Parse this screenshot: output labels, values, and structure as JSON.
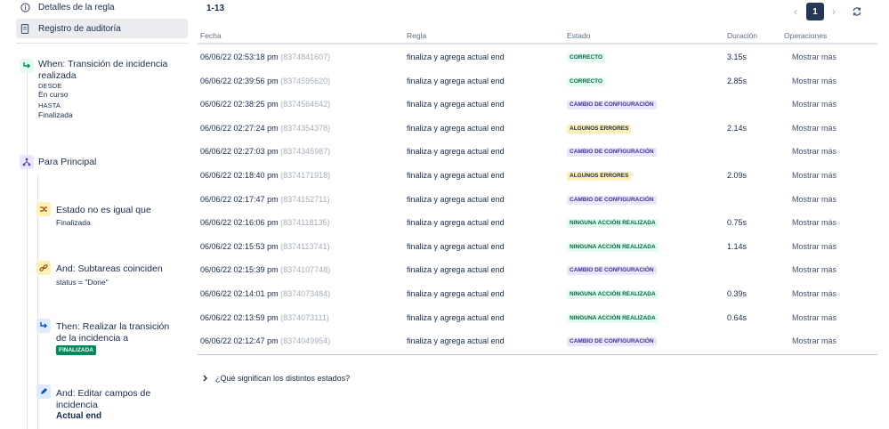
{
  "sidebar": {
    "nav": [
      {
        "label": "Detalles de la regla",
        "icon": "info-icon"
      },
      {
        "label": "Registro de auditoría",
        "icon": "document-icon"
      }
    ],
    "components": {
      "trigger": {
        "title_line1": "When: Transición de incidencia",
        "title_line2": "realizada",
        "from_label": "DESDE",
        "from_value": "En curso",
        "to_label": "HASTA",
        "to_value": "Finalizada"
      },
      "branch": {
        "title": "Para Principal"
      },
      "condition1": {
        "title": "Estado no es igual que",
        "detail": "Finalizada"
      },
      "condition2": {
        "title": "And: Subtareas coinciden",
        "detail": "status = \"Done\""
      },
      "action1": {
        "title_line1": "Then: Realizar la transición",
        "title_line2": "de la incidencia a",
        "lozenge": "FINALIZADA"
      },
      "action2": {
        "title_line1": "And: Editar campos de",
        "title_line2": "incidencia",
        "detail": "Actual end"
      }
    }
  },
  "main": {
    "count": "1-13",
    "pager": {
      "prev": "‹",
      "current": "1",
      "next": "›"
    },
    "columns": [
      "Fecha",
      "Regla",
      "Estado",
      "Duración",
      "Operaciones"
    ],
    "rows": [
      {
        "date": "06/06/22 02:53:18 pm",
        "id": "(8374841607)",
        "rule": "finaliza y agrega actual end",
        "status": "CORRECTO",
        "kind": "green",
        "duration": "3.15s",
        "op": "Mostrar más"
      },
      {
        "date": "06/06/22 02:39:56 pm",
        "id": "(8374595620)",
        "rule": "finaliza y agrega actual end",
        "status": "CORRECTO",
        "kind": "green",
        "duration": "2.85s",
        "op": "Mostrar más"
      },
      {
        "date": "06/06/22 02:38:25 pm",
        "id": "(8374564642)",
        "rule": "finaliza y agrega actual end",
        "status": "CAMBIO DE CONFIGURACIÓN",
        "kind": "purple",
        "duration": "",
        "op": "Mostrar más"
      },
      {
        "date": "06/06/22 02:27:24 pm",
        "id": "(8374354378)",
        "rule": "finaliza y agrega actual end",
        "status": "ALGUNOS ERRORES",
        "kind": "yellow",
        "duration": "2.14s",
        "op": "Mostrar más"
      },
      {
        "date": "06/06/22 02:27:03 pm",
        "id": "(8374345987)",
        "rule": "finaliza y agrega actual end",
        "status": "CAMBIO DE CONFIGURACIÓN",
        "kind": "purple",
        "duration": "",
        "op": "Mostrar más"
      },
      {
        "date": "06/06/22 02:18:40 pm",
        "id": "(8374171918)",
        "rule": "finaliza y agrega actual end",
        "status": "ALGUNOS ERRORES",
        "kind": "yellow",
        "duration": "2.09s",
        "op": "Mostrar más"
      },
      {
        "date": "06/06/22 02:17:47 pm",
        "id": "(8374152711)",
        "rule": "finaliza y agrega actual end",
        "status": "CAMBIO DE CONFIGURACIÓN",
        "kind": "purple",
        "duration": "",
        "op": "Mostrar más"
      },
      {
        "date": "06/06/22 02:16:06 pm",
        "id": "(8374118135)",
        "rule": "finaliza y agrega actual end",
        "status": "NINGUNA ACCIÓN REALIZADA",
        "kind": "green",
        "duration": "0.75s",
        "op": "Mostrar más"
      },
      {
        "date": "06/06/22 02:15:53 pm",
        "id": "(8374113741)",
        "rule": "finaliza y agrega actual end",
        "status": "NINGUNA ACCIÓN REALIZADA",
        "kind": "green",
        "duration": "1.14s",
        "op": "Mostrar más"
      },
      {
        "date": "06/06/22 02:15:39 pm",
        "id": "(8374107748)",
        "rule": "finaliza y agrega actual end",
        "status": "CAMBIO DE CONFIGURACIÓN",
        "kind": "purple",
        "duration": "",
        "op": "Mostrar más"
      },
      {
        "date": "06/06/22 02:14:01 pm",
        "id": "(8374073484)",
        "rule": "finaliza y agrega actual end",
        "status": "NINGUNA ACCIÓN REALIZADA",
        "kind": "green",
        "duration": "0.39s",
        "op": "Mostrar más"
      },
      {
        "date": "06/06/22 02:13:59 pm",
        "id": "(8374073111)",
        "rule": "finaliza y agrega actual end",
        "status": "NINGUNA ACCIÓN REALIZADA",
        "kind": "green",
        "duration": "0.64s",
        "op": "Mostrar más"
      },
      {
        "date": "06/06/22 02:12:47 pm",
        "id": "(8374049954)",
        "rule": "finaliza y agrega actual end",
        "status": "CAMBIO DE CONFIGURACIÓN",
        "kind": "purple",
        "duration": "",
        "op": "Mostrar más"
      }
    ],
    "faq": "¿Qué significan los distintos estados?"
  }
}
